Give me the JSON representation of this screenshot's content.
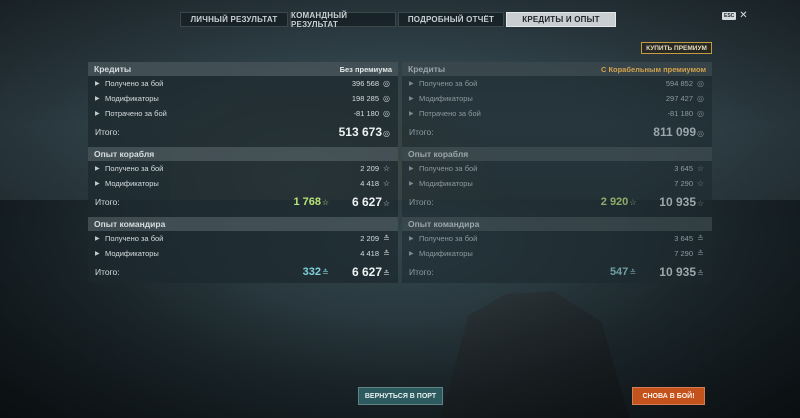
{
  "tabs": [
    {
      "label": "ЛИЧНЫЙ РЕЗУЛЬТАТ",
      "active": false
    },
    {
      "label": "КОМАНДНЫЙ РЕЗУЛЬТАТ",
      "active": false
    },
    {
      "label": "ПОДРОБНЫЙ ОТЧЁТ",
      "active": false
    },
    {
      "label": "КРЕДИТЫ И ОПЫТ",
      "active": true
    }
  ],
  "esc": {
    "key": "ESC",
    "close": "✕"
  },
  "buy_premium": "КУПИТЬ ПРЕМИУМ",
  "left": {
    "credits": {
      "title": "Кредиты",
      "note": "Без премиума",
      "rows": [
        {
          "label": "Получено за бой",
          "value": "396 568"
        },
        {
          "label": "Модификаторы",
          "value": "198 285"
        },
        {
          "label": "Потрачено за бой",
          "value": "-81 180"
        }
      ],
      "total_label": "Итого:",
      "total": "513 673"
    },
    "ship_xp": {
      "title": "Опыт корабля",
      "rows": [
        {
          "label": "Получено за бой",
          "value": "2 209"
        },
        {
          "label": "Модификаторы",
          "value": "4 418"
        }
      ],
      "total_label": "Итого:",
      "bonus": "1 768",
      "total": "6 627"
    },
    "captain_xp": {
      "title": "Опыт командира",
      "rows": [
        {
          "label": "Получено за бой",
          "value": "2 209"
        },
        {
          "label": "Модификаторы",
          "value": "4 418"
        }
      ],
      "total_label": "Итого:",
      "bonus": "332",
      "total": "6 627"
    }
  },
  "right": {
    "credits": {
      "title": "Кредиты",
      "note": "С Корабельным премиумом",
      "rows": [
        {
          "label": "Получено за бой",
          "value": "594 852"
        },
        {
          "label": "Модификаторы",
          "value": "297 427"
        },
        {
          "label": "Потрачено за бой",
          "value": "-81 180"
        }
      ],
      "total_label": "Итого:",
      "total": "811 099"
    },
    "ship_xp": {
      "title": "Опыт корабля",
      "rows": [
        {
          "label": "Получено за бой",
          "value": "3 645"
        },
        {
          "label": "Модификаторы",
          "value": "7 290"
        }
      ],
      "total_label": "Итого:",
      "bonus": "2 920",
      "total": "10 935"
    },
    "captain_xp": {
      "title": "Опыт командира",
      "rows": [
        {
          "label": "Получено за бой",
          "value": "3 645"
        },
        {
          "label": "Модификаторы",
          "value": "7 290"
        }
      ],
      "total_label": "Итого:",
      "bonus": "547",
      "total": "10 935"
    }
  },
  "icons": {
    "credits": "coin-icon",
    "ship_xp": "star-icon",
    "captain_xp": "captain-icon",
    "row_arrow": "chevron-right-icon"
  },
  "colors": {
    "free_xp_bonus": "#b7e37a",
    "captain_bonus": "#7fd0d8",
    "premium_accent": "#c59b42",
    "battle_button": "#c4521c",
    "port_button": "#2c5a5e"
  },
  "buttons": {
    "port": "ВЕРНУТЬСЯ В ПОРТ",
    "battle": "СНОВА В БОЙ!"
  }
}
